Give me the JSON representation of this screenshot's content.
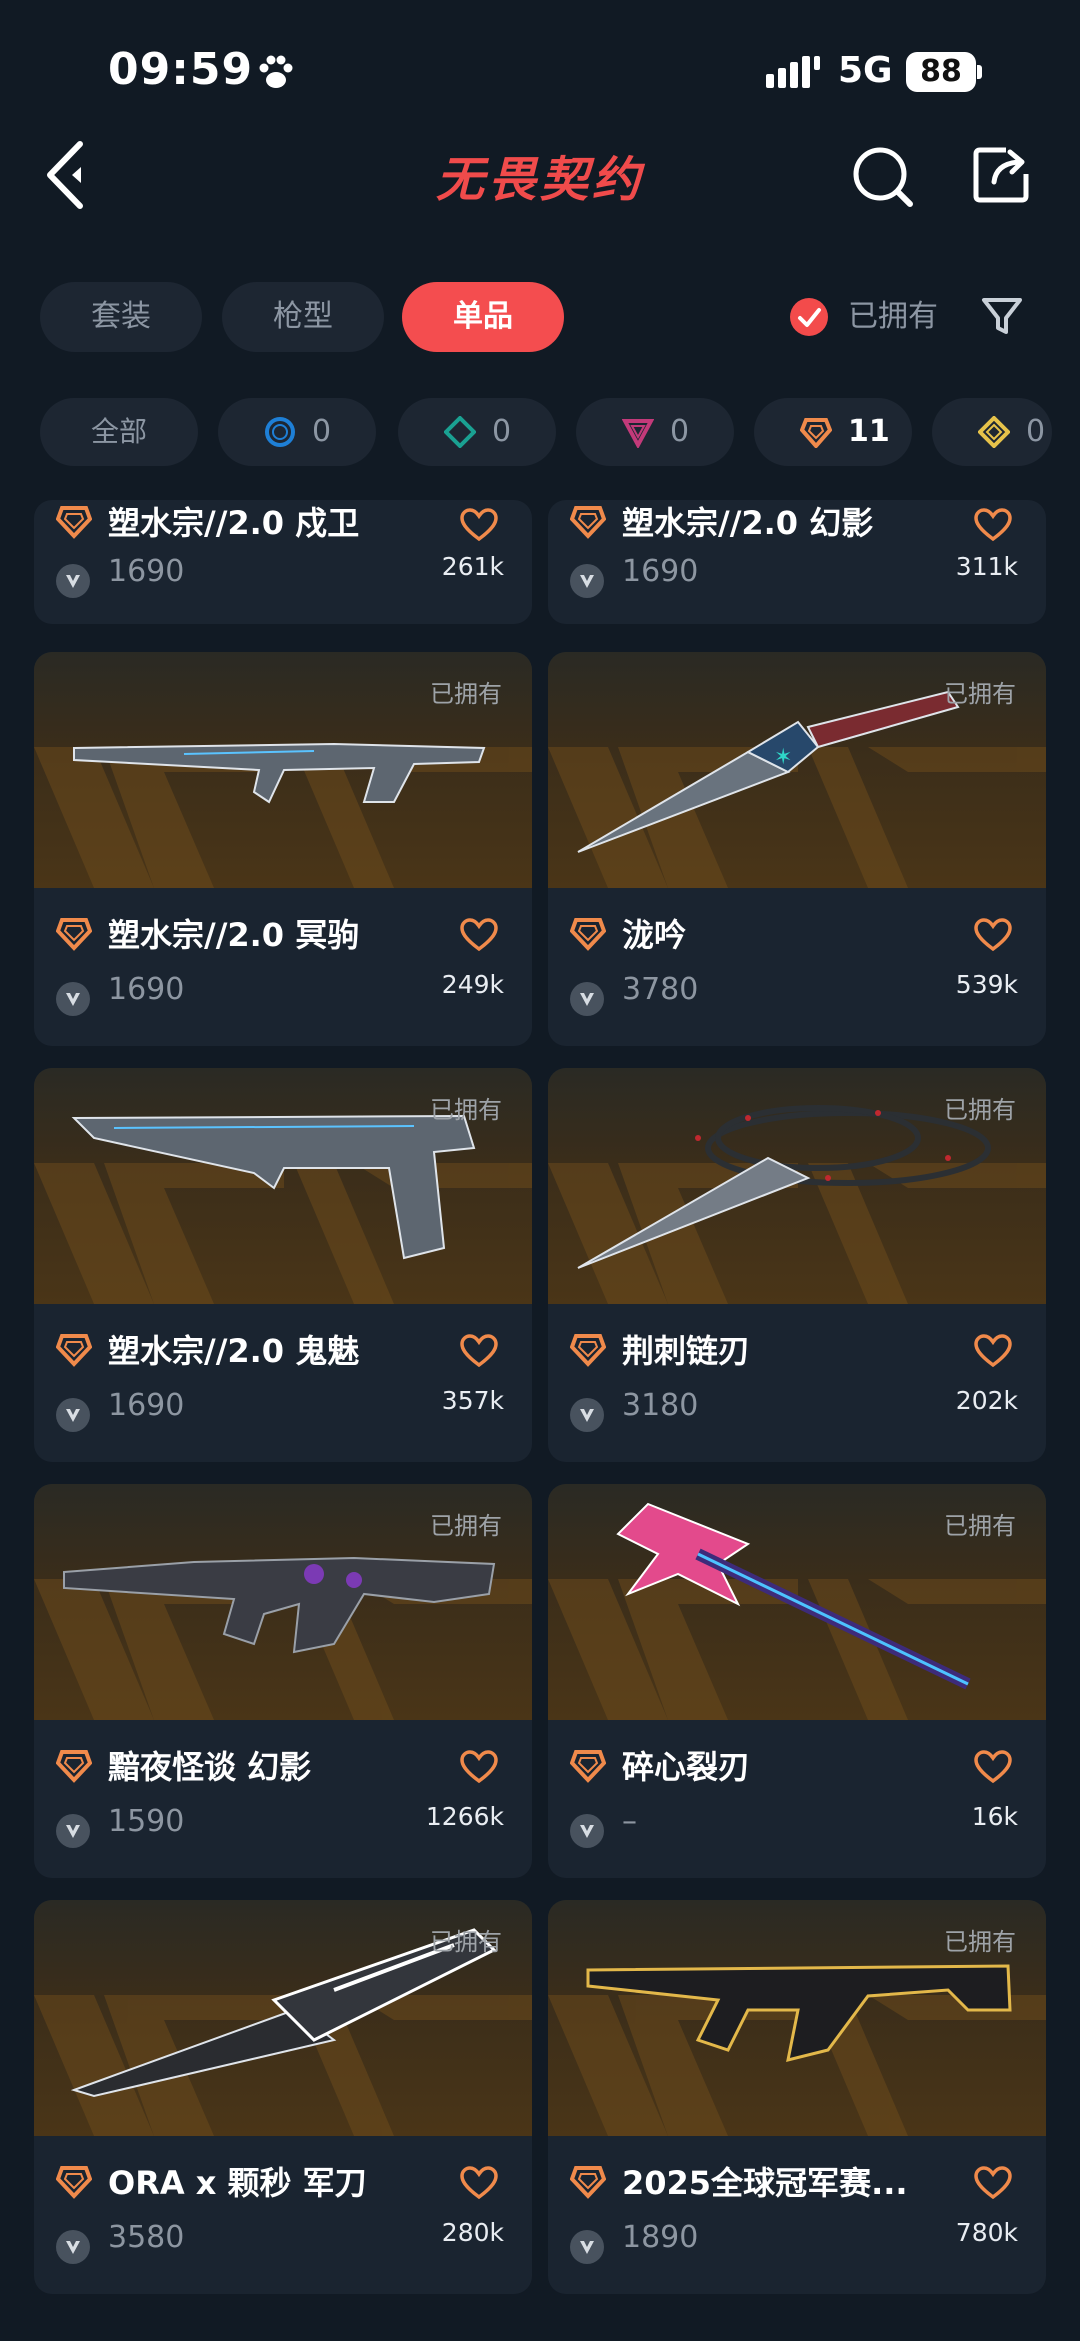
{
  "status": {
    "time": "09:59",
    "network": "5G",
    "battery": "88"
  },
  "header": {
    "title": "无畏契约"
  },
  "tabs": [
    {
      "label": "套装",
      "active": false
    },
    {
      "label": "枪型",
      "active": false
    },
    {
      "label": "单品",
      "active": true
    }
  ],
  "owned_filter": {
    "label": "已拥有",
    "checked": true
  },
  "rarity_chips": [
    {
      "label": "全部"
    },
    {
      "count": "0",
      "color": "#1e7fd6",
      "icon": "select-tier-icon"
    },
    {
      "count": "0",
      "color": "#1aa192",
      "icon": "deluxe-tier-icon"
    },
    {
      "count": "0",
      "color": "#c33a7a",
      "icon": "premium-tier-icon"
    },
    {
      "count": "11",
      "color": "#f08a4b",
      "icon": "exclusive-tier-icon"
    },
    {
      "count": "0",
      "color": "#e6c24a",
      "icon": "ultra-tier-icon"
    }
  ],
  "owned_badge": "已拥有",
  "items": [
    {
      "name": "塑水宗//2.0 戍卫",
      "price": "1690",
      "likes": "261k"
    },
    {
      "name": "塑水宗//2.0 幻影",
      "price": "1690",
      "likes": "311k"
    },
    {
      "name": "塑水宗//2.0 冥驹",
      "price": "1690",
      "likes": "249k",
      "owned": true
    },
    {
      "name": "泷吟",
      "price": "3780",
      "likes": "539k",
      "owned": true
    },
    {
      "name": "塑水宗//2.0 鬼魅",
      "price": "1690",
      "likes": "357k",
      "owned": true
    },
    {
      "name": "荆刺链刃",
      "price": "3180",
      "likes": "202k",
      "owned": true
    },
    {
      "name": "黯夜怪谈 幻影",
      "price": "1590",
      "likes": "1266k",
      "owned": true
    },
    {
      "name": "碎心裂刃",
      "price": "–",
      "likes": "16k",
      "owned": true
    },
    {
      "name": "ORA x 颗秒 军刀",
      "price": "3580",
      "likes": "280k",
      "owned": true
    },
    {
      "name": "2025全球冠军赛...",
      "price": "1890",
      "likes": "780k",
      "owned": true
    }
  ],
  "colors": {
    "accent": "#f44d4f",
    "tier_orange": "#f08a4b",
    "heart": "#f08a4b",
    "background": "#111a24"
  }
}
